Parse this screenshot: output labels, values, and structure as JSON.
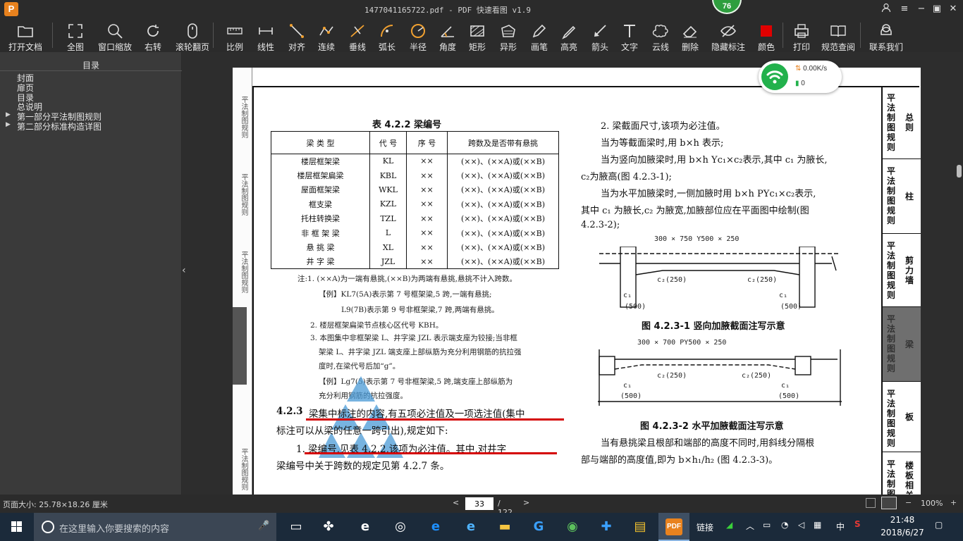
{
  "window": {
    "title": "1477041165722.pdf - PDF 快速看图 v1.9",
    "logo": "P",
    "badge": "76",
    "controls": [
      "user-icon",
      "menu-icon",
      "minimize-icon",
      "restore-icon",
      "close-icon"
    ]
  },
  "toolbar": [
    {
      "label": "打开文档",
      "icon": "folder-icon"
    },
    {
      "label": "全图",
      "icon": "fullscreen-icon"
    },
    {
      "label": "窗口缩放",
      "icon": "zoom-icon"
    },
    {
      "label": "右转",
      "icon": "rotate-icon"
    },
    {
      "label": "滚轮翻页",
      "icon": "mouse-icon"
    },
    {
      "label": "比例",
      "icon": "ruler-icon"
    },
    {
      "label": "线性",
      "icon": "linear-icon"
    },
    {
      "label": "对齐",
      "icon": "align-icon"
    },
    {
      "label": "连续",
      "icon": "continuous-icon"
    },
    {
      "label": "垂线",
      "icon": "perpendicular-icon"
    },
    {
      "label": "弧长",
      "icon": "arc-icon"
    },
    {
      "label": "半径",
      "icon": "radius-icon"
    },
    {
      "label": "角度",
      "icon": "angle-icon"
    },
    {
      "label": "矩形",
      "icon": "rect-icon"
    },
    {
      "label": "异形",
      "icon": "shape-icon"
    },
    {
      "label": "画笔",
      "icon": "pen-icon"
    },
    {
      "label": "高亮",
      "icon": "highlight-icon"
    },
    {
      "label": "箭头",
      "icon": "arrow-icon"
    },
    {
      "label": "文字",
      "icon": "text-icon"
    },
    {
      "label": "云线",
      "icon": "cloud-icon"
    },
    {
      "label": "删除",
      "icon": "eraser-icon"
    },
    {
      "label": "隐藏标注",
      "icon": "hide-icon"
    },
    {
      "label": "颜色",
      "icon": "color-icon"
    },
    {
      "label": "打印",
      "icon": "print-icon"
    },
    {
      "label": "规范查阅",
      "icon": "book-icon"
    },
    {
      "label": "联系我们",
      "icon": "contact-icon"
    }
  ],
  "sidebar": {
    "title": "目录",
    "items": [
      {
        "label": "封面",
        "expandable": false
      },
      {
        "label": "扉页",
        "expandable": false
      },
      {
        "label": "目录",
        "expandable": false
      },
      {
        "label": "总说明",
        "expandable": false
      },
      {
        "label": "第一部分平法制图规则",
        "expandable": true
      },
      {
        "label": "第二部分标准构造详图",
        "expandable": true
      }
    ]
  },
  "page": {
    "table_caption": "表 4.2.2   梁编号",
    "table_headers": [
      "梁 类 型",
      "代 号",
      "序 号",
      "跨数及是否带有悬挑"
    ],
    "table_rows": [
      [
        "楼层框架梁",
        "KL",
        "××",
        "(××)、(××A)或(××B)"
      ],
      [
        "楼层框架扁梁",
        "KBL",
        "××",
        "(××)、(××A)或(××B)"
      ],
      [
        "屋面框架梁",
        "WKL",
        "××",
        "(××)、(××A)或(××B)"
      ],
      [
        "框支梁",
        "KZL",
        "××",
        "(××)、(××A)或(××B)"
      ],
      [
        "托柱转换梁",
        "TZL",
        "××",
        "(××)、(××A)或(××B)"
      ],
      [
        "非 框 架 梁",
        "L",
        "××",
        "(××)、(××A)或(××B)"
      ],
      [
        "悬  挑  梁",
        "XL",
        "××",
        "(××)、(××A)或(××B)"
      ],
      [
        "井  字  梁",
        "JZL",
        "××",
        "(××)、(××A)或(××B)"
      ]
    ],
    "notes": [
      "注:1. (××A)为一端有悬挑,(××B)为两端有悬挑,悬挑不计入跨数。",
      "【例】KL7(5A)表示第 7 号框架梁,5 跨,一端有悬挑;",
      "L9(7B)表示第 9 号非框架梁,7 跨,两端有悬挑。",
      "2. 楼层框架扁梁节点核心区代号 KBH。",
      "3. 本图集中非框架梁 L、井字梁 JZL 表示端支座为铰接;当非框",
      "架梁 L、井字梁 JZL 端支座上部纵筋为充分利用钢筋的抗拉强",
      "度时,在梁代号后加“g”。",
      "【例】Lg7(5)表示第 7 号非框架梁,5 跨,端支座上部纵筋为",
      "充分利用钢筋的抗拉强度。"
    ],
    "para_423_num": "4.2.3",
    "para_423_a": "梁集中标注的内容,有五项必注值及一项选注值(集中",
    "para_423_b": "标注可以从梁的任意一跨引出),规定如下:",
    "para_1_a": "1. 梁编号,见表 4.2.2,该项为必注值。其中,对井字",
    "para_1_b": "梁编号中关于跨数的规定见第 4.2.7 条。",
    "right_lines": [
      "2. 梁截面尺寸,该项为必注值。",
      "当为等截面梁时,用 b×h 表示;",
      "当为竖向加腋梁时,用 b×h   Yc₁×c₂表示,其中 c₁ 为腋长,",
      "c₂为腋高(图 4.2.3-1);",
      "当为水平加腋梁时,一侧加腋时用 b×h   PYc₁×c₂表示,",
      "其中 c₁ 为腋长,c₂ 为腋宽,加腋部位应在平面图中绘制(图",
      "4.2.3-2);"
    ],
    "fig1_dim": "300 × 750  Y500 × 250",
    "fig1_caption": "图 4.2.3-1  竖向加腋截面注写示意",
    "fig2_dim": "300 × 700  PY500 × 250",
    "fig2_caption": "图 4.2.3-2  水平加腋截面注写示意",
    "fig_labels": {
      "c1": "c₁",
      "c2": "c₂",
      "v500": "(500)",
      "v250": "(250)"
    },
    "bottom_lines": [
      "当有悬挑梁且根部和端部的高度不同时,用斜线分隔根",
      "部与端部的高度值,即为 b×h₁/h₂ (图 4.2.3-3)。"
    ],
    "left_strip": [
      "平法制图规则",
      "平法制图规则",
      "平法制图规则",
      "平法制图规则",
      "平法制图规则"
    ],
    "index_tabs": [
      {
        "v": "平法制图规则",
        "n": "总则",
        "active": false
      },
      {
        "v": "平法制图规则",
        "n": "柱",
        "active": false
      },
      {
        "v": "平法制图规则",
        "n": "剪力墙",
        "active": false
      },
      {
        "v": "平法制图规则",
        "n": "梁",
        "active": true
      },
      {
        "v": "平法制图规则",
        "n": "板",
        "active": false
      },
      {
        "v": "平法制图规则",
        "n": "楼板相关",
        "active": false
      }
    ]
  },
  "network_widget": {
    "speed": "0.00K/s",
    "count": "0"
  },
  "status": {
    "page_size": "页面大小: 25.78×18.26 厘米",
    "current_page": "33",
    "total_pages": "/ 122",
    "zoom": "100%",
    "prev": "<",
    "next": ">"
  },
  "taskbar": {
    "search_placeholder": "在这里输入你要搜索的内容",
    "tray_link": "链接",
    "ime": "中",
    "time": "21:48",
    "date": "2018/6/27"
  },
  "colors": {
    "accent_red": "#d40000",
    "wifi_green": "#22b14c",
    "badge_green": "#2e9e3e"
  }
}
